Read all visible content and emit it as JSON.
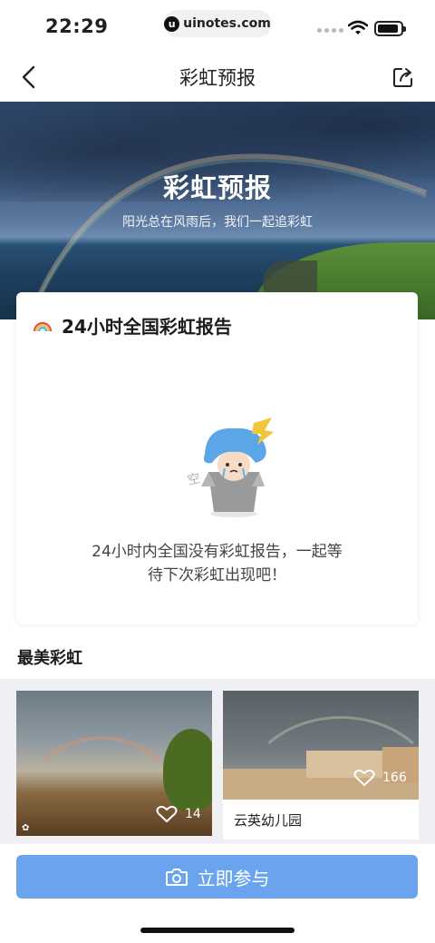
{
  "status_bar": {
    "time": "22:29",
    "url": "uinotes.com",
    "url_logo": "u"
  },
  "nav": {
    "title": "彩虹预报",
    "back_icon": "chevron-left-icon",
    "share_icon": "share-icon"
  },
  "hero": {
    "title": "彩虹预报",
    "subtitle": "阳光总在风雨后，我们一起追彩虹"
  },
  "report": {
    "icon": "rainbow-icon",
    "title": "24小时全国彩虹报告",
    "empty_mark": "空",
    "empty_message_line1": "24小时内全国没有彩虹报告，一起等",
    "empty_message_line2": "待下次彩虹出现吧！"
  },
  "gallery": {
    "title": "最美彩虹",
    "photos": [
      {
        "likes": "14",
        "caption": ""
      },
      {
        "likes": "166",
        "caption": "云英幼儿园"
      }
    ]
  },
  "action": {
    "join_label": "立即参与",
    "camera_icon": "camera-icon"
  },
  "colors": {
    "accent": "#6aa4ee",
    "gallery_bg": "#eef0f4"
  }
}
